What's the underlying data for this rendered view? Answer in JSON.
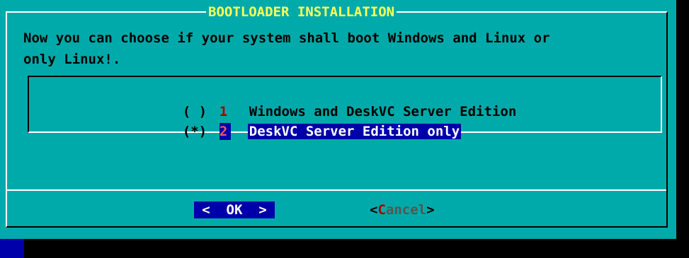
{
  "dialog": {
    "title": "BOOTLOADER INSTALLATION",
    "message_line1": "Now you can choose if your system shall boot Windows and Linux or",
    "message_line2": "only Linux!."
  },
  "options": [
    {
      "radio": "( )",
      "tag": "1",
      "label": "Windows and DeskVC Server Edition",
      "selected": false
    },
    {
      "radio": "(*)",
      "tag": "2",
      "label": "DeskVC Server Edition only",
      "selected": true
    }
  ],
  "buttons": {
    "ok_label": "<  OK  >",
    "cancel_open": "<",
    "cancel_hot": "C",
    "cancel_rest": "ancel",
    "cancel_close": ">"
  },
  "colors": {
    "dialog_bg": "#00aaaa",
    "title": "#ffff55",
    "selection_bg": "#0000aa",
    "hotkey": "#aa0000"
  }
}
